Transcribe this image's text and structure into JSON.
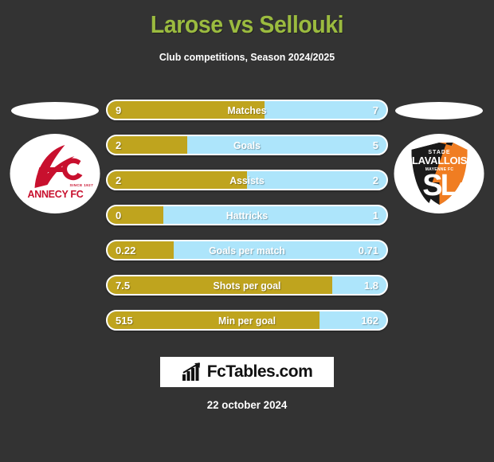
{
  "header": {
    "title": "Larose vs Sellouki",
    "subtitle": "Club competitions, Season 2024/2025",
    "title_color": "#9bbb3f"
  },
  "teams": {
    "home": {
      "name": "Annecy FC",
      "crest_name": "annecy-fc-crest",
      "crest_text": "ANNECY FC",
      "crest_monogram": "FC",
      "crest_since": "SINCE 1927",
      "primary_color": "#c8102e"
    },
    "away": {
      "name": "Stade Lavallois",
      "crest_name": "stade-lavallois-crest",
      "crest_text_top": "STADE",
      "crest_text_main": "LAVALLOIS",
      "crest_text_sub": "MAYENNE FC",
      "crest_monogram": "SL",
      "primary_color": "#f07d22",
      "secondary_color": "#1a1a1a"
    }
  },
  "colors": {
    "background": "#333333",
    "home_bar": "#bfa41e",
    "away_bar": "#ade5fb",
    "text": "#ffffff"
  },
  "stats": [
    {
      "label": "Matches",
      "home": "9",
      "away": "7",
      "home_pct": 56.2
    },
    {
      "label": "Goals",
      "home": "2",
      "away": "5",
      "home_pct": 28.6
    },
    {
      "label": "Assists",
      "home": "2",
      "away": "2",
      "home_pct": 50.0
    },
    {
      "label": "Hattricks",
      "home": "0",
      "away": "1",
      "home_pct": 20.0
    },
    {
      "label": "Goals per match",
      "home": "0.22",
      "away": "0.71",
      "home_pct": 23.7
    },
    {
      "label": "Shots per goal",
      "home": "7.5",
      "away": "1.8",
      "home_pct": 80.6
    },
    {
      "label": "Min per goal",
      "home": "515",
      "away": "162",
      "home_pct": 76.1
    }
  ],
  "footer": {
    "logo_text": "FcTables.com",
    "logo_icon": "bar-chart-icon",
    "date": "22 october 2024"
  }
}
